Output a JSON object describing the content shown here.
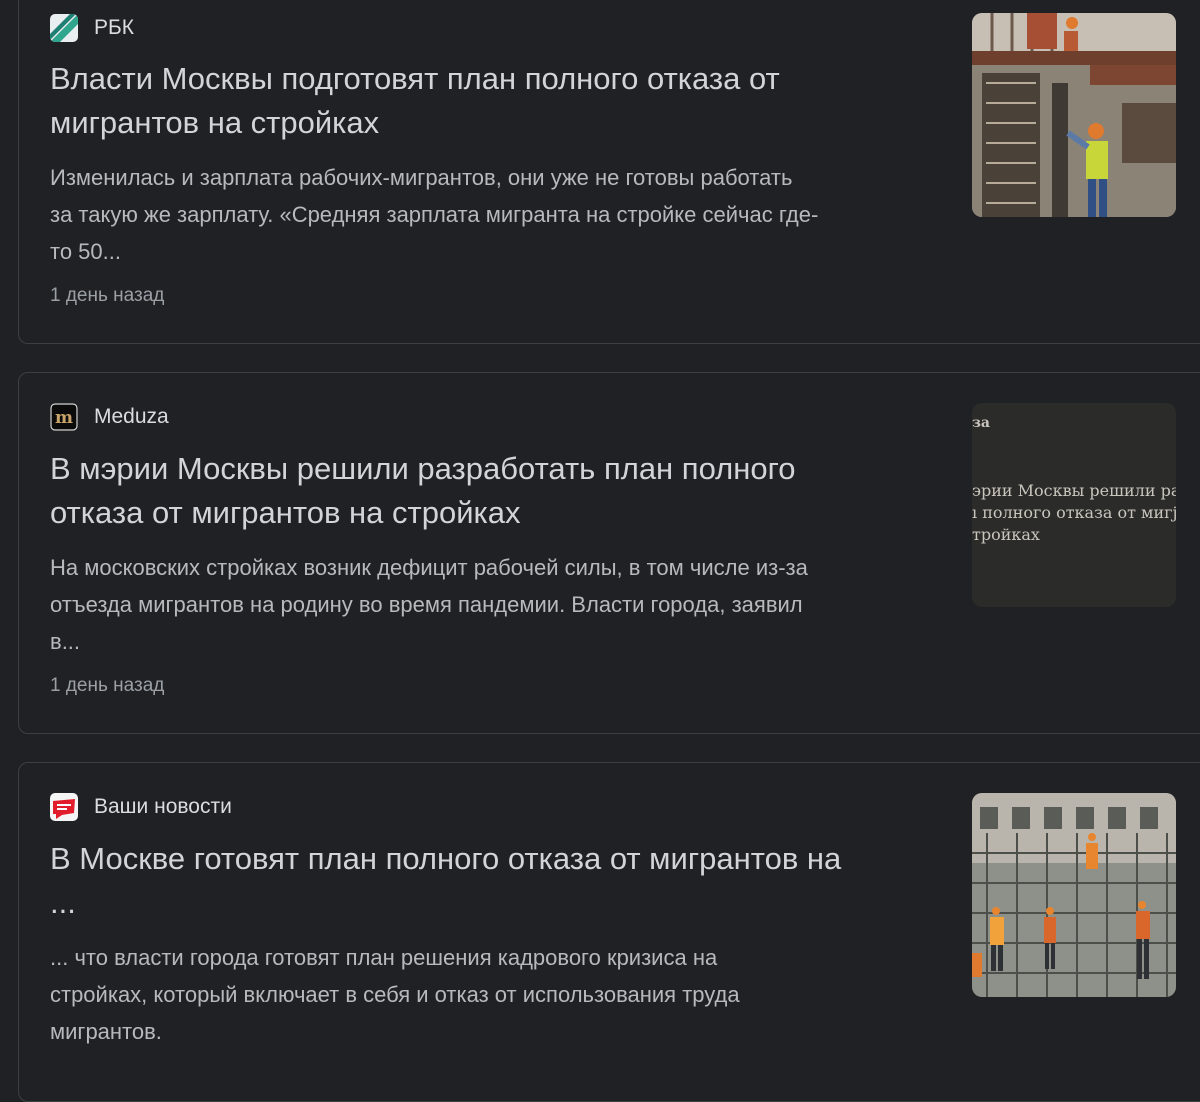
{
  "articles": [
    {
      "source": "РБК",
      "title_line1": "Власти Москвы подготовят план полного отказа от",
      "title_line2": "мигрантов на стройках",
      "snippet_line1": "Изменилась и зарплата рабочих-мигрантов, они уже не готовы работать",
      "snippet_line2": "за такую же зарплату. «Средняя зарплата мигранта на стройке сейчас где-",
      "snippet_line3": "то 50...",
      "time": "1 день назад",
      "thumbnail": "construction-workers-photo"
    },
    {
      "source": "Meduza",
      "title_line1": "В мэрии Москвы решили разработать план полного",
      "title_line2": "отказа от мигрантов на стройках",
      "snippet_line1": "На московских стройках возник дефицит рабочей силы, в том числе из-за",
      "snippet_line2": "отъезда мигрантов на родину во время пандемии. Власти города, заявил",
      "snippet_line3": "в...",
      "time": "1 день назад",
      "thumbnail_text": {
        "brand": "зa",
        "line1": "эрии Москвы решили ра",
        "line2": "ı полного отказа от мигј",
        "line3": "тройках"
      }
    },
    {
      "source": "Ваши новости",
      "title_line1": "В Москве готовят план полного отказа от мигрантов на",
      "title_line2": "...",
      "snippet_line1": "... что власти города готовят план решения кадрового кризиса на",
      "snippet_line2": "стройках, который включает в себя и отказ от использования труда",
      "snippet_line3": "мигрантов.",
      "thumbnail": "rebar-construction-photo"
    }
  ],
  "colors": {
    "background": "#202124",
    "card_border": "#3c4043",
    "title": "#d2d4d7",
    "snippet": "#b7b9bd",
    "meta": "#9aa0a6"
  }
}
